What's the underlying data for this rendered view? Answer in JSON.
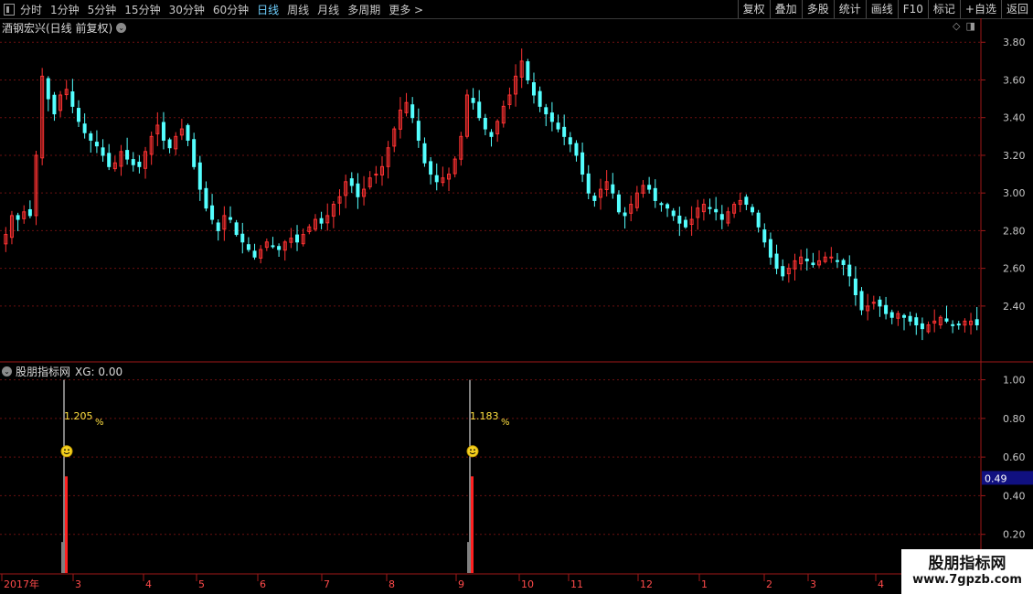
{
  "toolbar": {
    "periods": [
      "分时",
      "1分钟",
      "5分钟",
      "15分钟",
      "30分钟",
      "60分钟",
      "日线",
      "周线",
      "月线",
      "多周期",
      "更多 >"
    ],
    "active_period": "日线",
    "buttons": [
      "复权",
      "叠加",
      "多股",
      "统计",
      "画线",
      "F10",
      "标记",
      "+自选",
      "返回"
    ]
  },
  "main_chart": {
    "title": "酒钢宏兴(日线 前复权)",
    "y_ticks": [
      "3.80",
      "3.60",
      "3.40",
      "3.20",
      "3.00",
      "2.80",
      "2.60",
      "2.40"
    ],
    "up_color": "#ff3232",
    "down_color": "#54ffff"
  },
  "indicator": {
    "title": "股朋指标网",
    "xg_label": "XG: 0.00",
    "y_ticks": [
      "1.00",
      "0.80",
      "0.60",
      "0.40",
      "0.20"
    ],
    "current_value": "0.49",
    "signals": [
      {
        "label": "1.205",
        "unit": "%",
        "value": 1.0
      },
      {
        "label": "1.183",
        "unit": "%",
        "value": 1.0
      }
    ]
  },
  "time_axis": {
    "labels": [
      "2017年",
      "3",
      "4",
      "5",
      "6",
      "7",
      "8",
      "9",
      "10",
      "11",
      "12",
      "1",
      "2",
      "3",
      "4"
    ]
  },
  "watermark": {
    "line1": "股朋指标网",
    "line2": "www.7gpzb.com"
  },
  "chart_data": {
    "type": "candlestick",
    "title": "酒钢宏兴(日线 前复权)",
    "price_ylim": [
      2.22,
      3.84
    ],
    "price_y_ticks": [
      3.8,
      3.6,
      3.4,
      3.2,
      3.0,
      2.8,
      2.6,
      2.4
    ],
    "close_series": [
      2.78,
      2.88,
      2.86,
      2.9,
      2.88,
      3.2,
      3.62,
      3.5,
      3.42,
      3.52,
      3.55,
      3.46,
      3.38,
      3.32,
      3.28,
      3.25,
      3.2,
      3.14,
      3.16,
      3.22,
      3.18,
      3.15,
      3.14,
      3.22,
      3.3,
      3.36,
      3.28,
      3.24,
      3.3,
      3.34,
      3.28,
      3.14,
      3.02,
      2.92,
      2.86,
      2.8,
      2.88,
      2.86,
      2.78,
      2.74,
      2.7,
      2.66,
      2.7,
      2.74,
      2.72,
      2.7,
      2.74,
      2.76,
      2.74,
      2.78,
      2.82,
      2.86,
      2.84,
      2.88,
      2.94,
      2.98,
      3.06,
      3.04,
      2.98,
      3.02,
      3.08,
      3.1,
      3.14,
      3.24,
      3.34,
      3.44,
      3.48,
      3.4,
      3.28,
      3.16,
      3.1,
      3.06,
      3.08,
      3.1,
      3.18,
      3.3,
      3.52,
      3.48,
      3.4,
      3.34,
      3.3,
      3.38,
      3.46,
      3.52,
      3.62,
      3.7,
      3.6,
      3.52,
      3.46,
      3.42,
      3.38,
      3.34,
      3.3,
      3.26,
      3.2,
      3.1,
      3.0,
      2.96,
      3.02,
      3.06,
      3.0,
      2.9,
      2.88,
      2.94,
      3.0,
      3.04,
      3.02,
      2.96,
      2.94,
      2.92,
      2.88,
      2.84,
      2.82,
      2.86,
      2.92,
      2.94,
      2.92,
      2.9,
      2.86,
      2.9,
      2.94,
      2.96,
      2.94,
      2.9,
      2.82,
      2.74,
      2.66,
      2.6,
      2.56,
      2.6,
      2.64,
      2.66,
      2.64,
      2.62,
      2.64,
      2.66,
      2.66,
      2.64,
      2.62,
      2.56,
      2.46,
      2.38,
      2.4,
      2.42,
      2.4,
      2.36,
      2.34,
      2.36,
      2.34,
      2.32,
      2.3,
      2.28,
      2.3,
      2.32,
      2.34,
      2.32,
      2.3,
      2.3,
      2.32,
      2.32,
      2.3
    ],
    "indicator_ylim": [
      0,
      1.05
    ],
    "indicator_y_ticks": [
      1.0,
      0.8,
      0.6,
      0.4,
      0.2
    ],
    "indicator_spikes": [
      {
        "label": "1.205%",
        "value": 1.0
      },
      {
        "label": "1.183%",
        "value": 1.0
      }
    ],
    "x_labels": [
      "2017年",
      "3",
      "4",
      "5",
      "6",
      "7",
      "8",
      "9",
      "10",
      "11",
      "12",
      "1",
      "2",
      "3",
      "4"
    ]
  }
}
